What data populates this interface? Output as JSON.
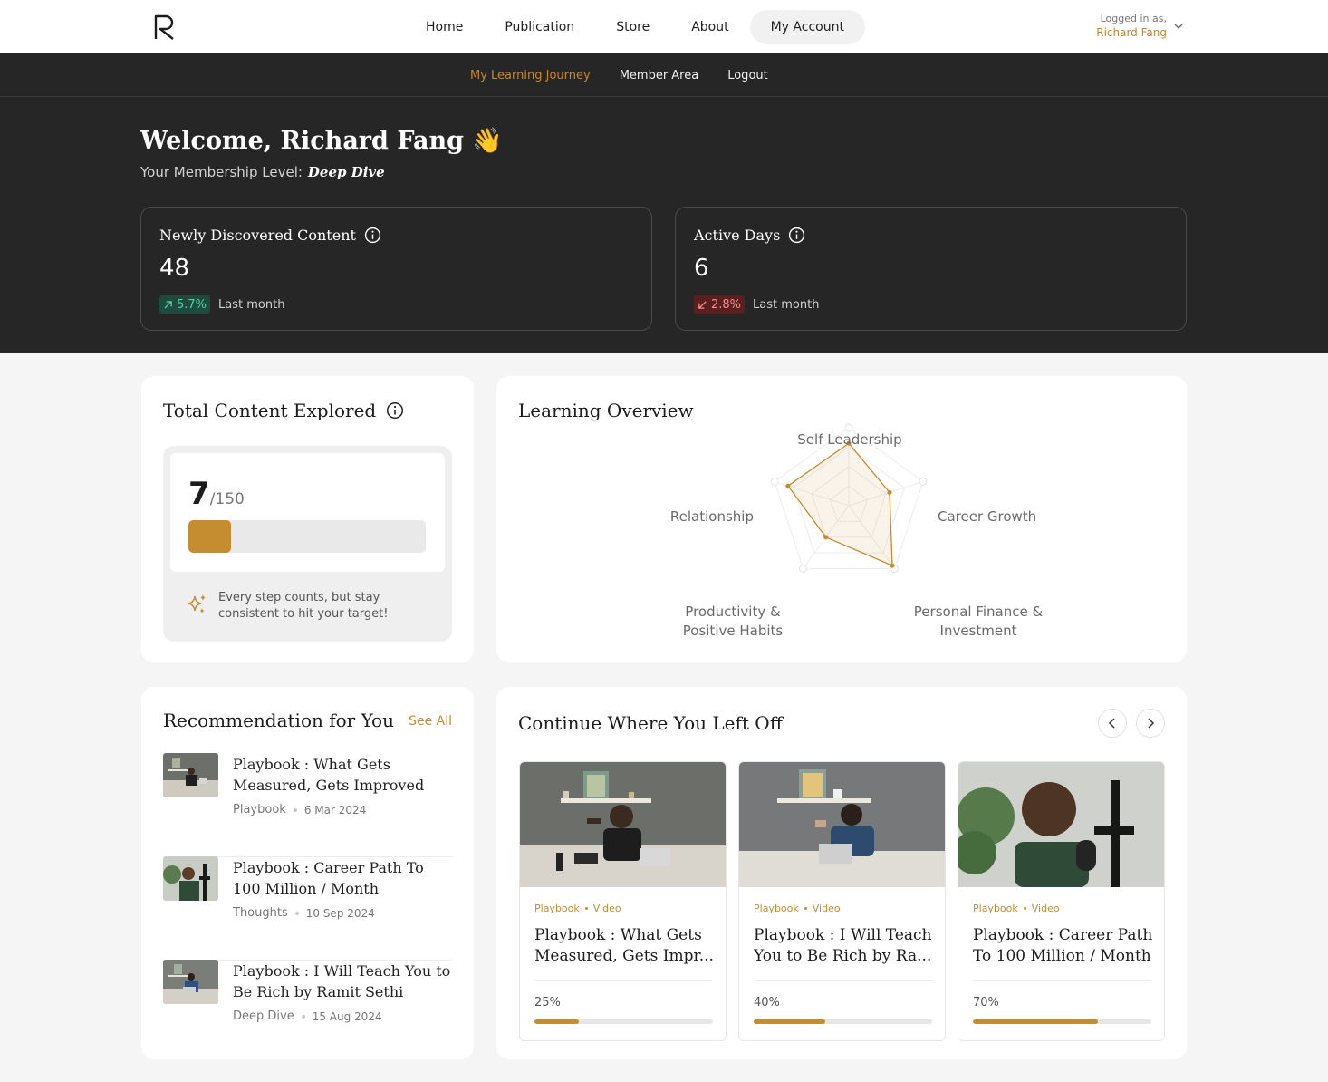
{
  "brand": {
    "logo_icon": "r-logo-icon",
    "accent": "#c58d2f"
  },
  "nav": {
    "items": [
      "Home",
      "Publication",
      "Store",
      "About",
      "My Account"
    ],
    "active": "My Account"
  },
  "user": {
    "logged_label": "Logged in as,",
    "name": "Richard Fang"
  },
  "subnav": {
    "items": [
      "My Learning Journey",
      "Member Area",
      "Logout"
    ],
    "active": "My Learning Journey"
  },
  "hero": {
    "welcome": "Welcome, Richard Fang 👋",
    "membership_label": "Your Membership Level:",
    "membership_level": "Deep Dive"
  },
  "stats": [
    {
      "title": "Newly Discovered Content",
      "value": "48",
      "change": "5.7%",
      "direction": "up",
      "period": "Last month"
    },
    {
      "title": "Active Days",
      "value": "6",
      "change": "2.8%",
      "direction": "down",
      "period": "Last month"
    }
  ],
  "total": {
    "title": "Total Content Explored",
    "explored": "7",
    "total_label": "/150",
    "explored_fraction": 0.047,
    "motto": "Every step counts, but stay consistent to hit your target!"
  },
  "learning_overview": {
    "title": "Learning Overview",
    "axes": [
      "Self Leadership",
      "Career Growth",
      "Personal Finance & Investment",
      "Productivity & Positive Habits",
      "Relationship"
    ],
    "values": [
      0.8,
      0.55,
      0.95,
      0.5,
      0.82
    ]
  },
  "recommendation": {
    "title": "Recommendation for You",
    "see_all": "See All",
    "items": [
      {
        "title": "Playbook : What Gets Measured, Gets Improved",
        "category": "Playbook",
        "date": "6 Mar 2024"
      },
      {
        "title": "Playbook : Career Path To 100 Million / Month",
        "category": "Thoughts",
        "date": "10 Sep 2024"
      },
      {
        "title": "Playbook : I Will Teach You to Be Rich by Ramit Sethi",
        "category": "Deep Dive",
        "date": "15 Aug 2024"
      }
    ]
  },
  "continue": {
    "title": "Continue Where You Left Off",
    "items": [
      {
        "category": "Playbook",
        "type": "Video",
        "title": "Playbook : What Gets Measured, Gets Impr...",
        "progress_label": "25%",
        "progress": 0.25
      },
      {
        "category": "Playbook",
        "type": "Video",
        "title": "Playbook : I Will Teach You to Be Rich by Ra...",
        "progress_label": "40%",
        "progress": 0.4
      },
      {
        "category": "Playbook",
        "type": "Video",
        "title": "Playbook : Career Path To 100 Million / Month",
        "progress_label": "70%",
        "progress": 0.7
      }
    ]
  }
}
